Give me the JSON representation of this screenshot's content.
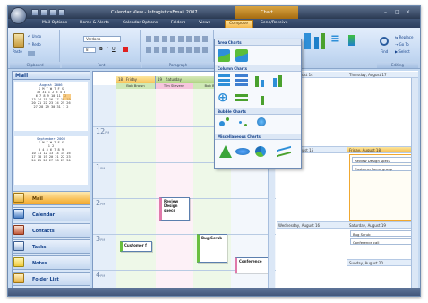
{
  "window": {
    "title": "Calendar View - InfragisticsEmail 2007"
  },
  "contextual_tab": {
    "label": "Chart"
  },
  "ribbon_tabs": [
    "Mail Options",
    "Home & Alerts",
    "Calendar Options",
    "Folders",
    "Views",
    "Compose",
    "Send/Receive"
  ],
  "active_tab": "Compose",
  "ribbon": {
    "groups": [
      "Clipboard",
      "Font",
      "Paragraph",
      "Editing"
    ],
    "paste": "Paste",
    "undo": "Undo",
    "redo": "Redo",
    "font_name": "Verdana",
    "font_size": "8",
    "find": "Find",
    "replace": "Replace",
    "goto": "Go To",
    "select": "Select"
  },
  "chart_dropdown": {
    "sections": [
      "Area Charts",
      "Column Charts",
      "Bubble Charts",
      "Miscellaneous Charts"
    ]
  },
  "nav": {
    "title": "Mail",
    "buttons": [
      "Mail",
      "Calendar",
      "Contacts",
      "Tasks",
      "Notes",
      "Folder List"
    ],
    "active": "Mail",
    "cal1": {
      "title": "August 2006",
      "days": "S M T W T F S",
      "weeks": [
        "30 31  1  2  3  4  5",
        " 6  7  8  9 10 11 12",
        "13 14 15 16 17 18 19",
        "20 21 22 23 24 25 26",
        "27 28 29 30 31  1  2"
      ]
    },
    "cal2": {
      "title": "September 2006",
      "days": "S M T W T F S",
      "weeks": [
        "                1  2",
        " 3  4  5  6  7  8  9",
        "10 11 12 13 14 15 16",
        "17 18 19 20 21 22 23",
        "24 25 26 27 28 29 30"
      ]
    }
  },
  "day_view": {
    "headers": [
      "18",
      "Friday",
      "19",
      "Saturday",
      "20",
      "Su"
    ],
    "people": [
      "Bob Brown",
      "Tim Stevens",
      "Bob Br..."
    ],
    "hours": [
      "12",
      "1",
      "2",
      "3",
      "4"
    ],
    "hour_suffix": "PM",
    "appointments": [
      "Review Design specs",
      "Customer f",
      "Bug Scrub",
      "Conference"
    ]
  },
  "week_view": {
    "days": [
      "Monday, August 14",
      "Thursday, August 17",
      "Tuesday, August 15",
      "Friday, August 18",
      "Wednesday, August 16",
      "Saturday, August 19",
      "Sunday, August 20"
    ],
    "friday_items": [
      "Review Design specs",
      "Customer focus group"
    ],
    "saturday_items": [
      "Bug Scrub",
      "Conference call"
    ]
  }
}
